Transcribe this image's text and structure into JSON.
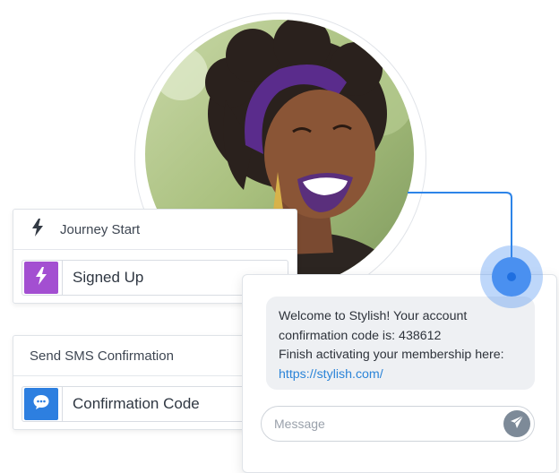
{
  "journey": {
    "header": "Journey Start",
    "trigger_label": "Signed Up",
    "trigger_color": "#a34fd1"
  },
  "sms_step": {
    "header": "Send SMS Confirmation",
    "message_label": "Confirmation Code",
    "icon_color": "#2d7fe0"
  },
  "sms_preview": {
    "lines": [
      "Welcome to Stylish! Your account",
      "confirmation code is: 438612",
      "Finish activating your membership here:"
    ],
    "link": "https://stylish.com/",
    "input_placeholder": "Message",
    "link_color": "#2b84d8"
  },
  "accent_color": "#2d84e8"
}
